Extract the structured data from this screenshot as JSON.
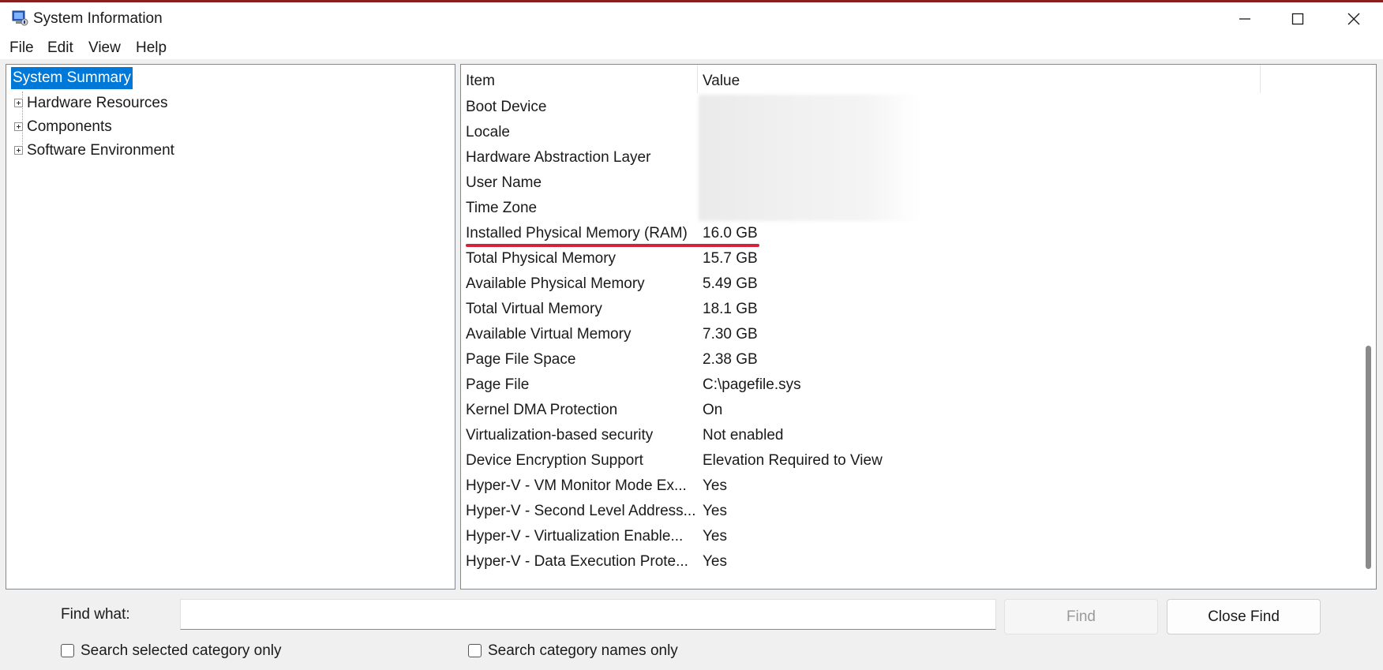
{
  "window": {
    "title": "System Information",
    "icon": "system-info-icon",
    "controls": [
      "minimize-icon",
      "maximize-icon",
      "close-icon"
    ]
  },
  "menu": {
    "items": [
      "File",
      "Edit",
      "View",
      "Help"
    ]
  },
  "tree": {
    "items": [
      {
        "label": "System Summary",
        "selected": true,
        "expandable": false
      },
      {
        "label": "Hardware Resources",
        "selected": false,
        "expandable": true
      },
      {
        "label": "Components",
        "selected": false,
        "expandable": true
      },
      {
        "label": "Software Environment",
        "selected": false,
        "expandable": true
      }
    ]
  },
  "list": {
    "columns": [
      "Item",
      "Value"
    ],
    "rows": [
      {
        "item": "Boot Device",
        "value": ""
      },
      {
        "item": "Locale",
        "value": ""
      },
      {
        "item": "Hardware Abstraction Layer",
        "value": ""
      },
      {
        "item": "User Name",
        "value": ""
      },
      {
        "item": "Time Zone",
        "value": ""
      },
      {
        "item": "Installed Physical Memory (RAM)",
        "value": "16.0 GB"
      },
      {
        "item": "Total Physical Memory",
        "value": "15.7 GB"
      },
      {
        "item": "Available Physical Memory",
        "value": "5.49 GB"
      },
      {
        "item": "Total Virtual Memory",
        "value": "18.1 GB"
      },
      {
        "item": "Available Virtual Memory",
        "value": "7.30 GB"
      },
      {
        "item": "Page File Space",
        "value": "2.38 GB"
      },
      {
        "item": "Page File",
        "value": "C:\\pagefile.sys"
      },
      {
        "item": "Kernel DMA Protection",
        "value": "On"
      },
      {
        "item": "Virtualization-based security",
        "value": "Not enabled"
      },
      {
        "item": "Device Encryption Support",
        "value": "Elevation Required to View"
      },
      {
        "item": "Hyper-V - VM Monitor Mode Ex...",
        "value": "Yes"
      },
      {
        "item": "Hyper-V - Second Level Address...",
        "value": "Yes"
      },
      {
        "item": "Hyper-V - Virtualization Enable...",
        "value": "Yes"
      },
      {
        "item": "Hyper-V - Data Execution Prote...",
        "value": "Yes"
      }
    ],
    "blurred_rows": [
      "Boot Device",
      "Locale",
      "Hardware Abstraction Layer",
      "User Name",
      "Time Zone"
    ],
    "highlighted_row": "Installed Physical Memory (RAM)",
    "highlight_color": "#d2233c"
  },
  "find": {
    "label": "Find what:",
    "value": "",
    "find_button": "Find",
    "close_button": "Close Find",
    "option1": "Search selected category only",
    "option2": "Search category names only"
  },
  "colors": {
    "selection": "#0078d7",
    "chrome": "#f0f0f0",
    "accent_strip": "#8a1f1f"
  }
}
